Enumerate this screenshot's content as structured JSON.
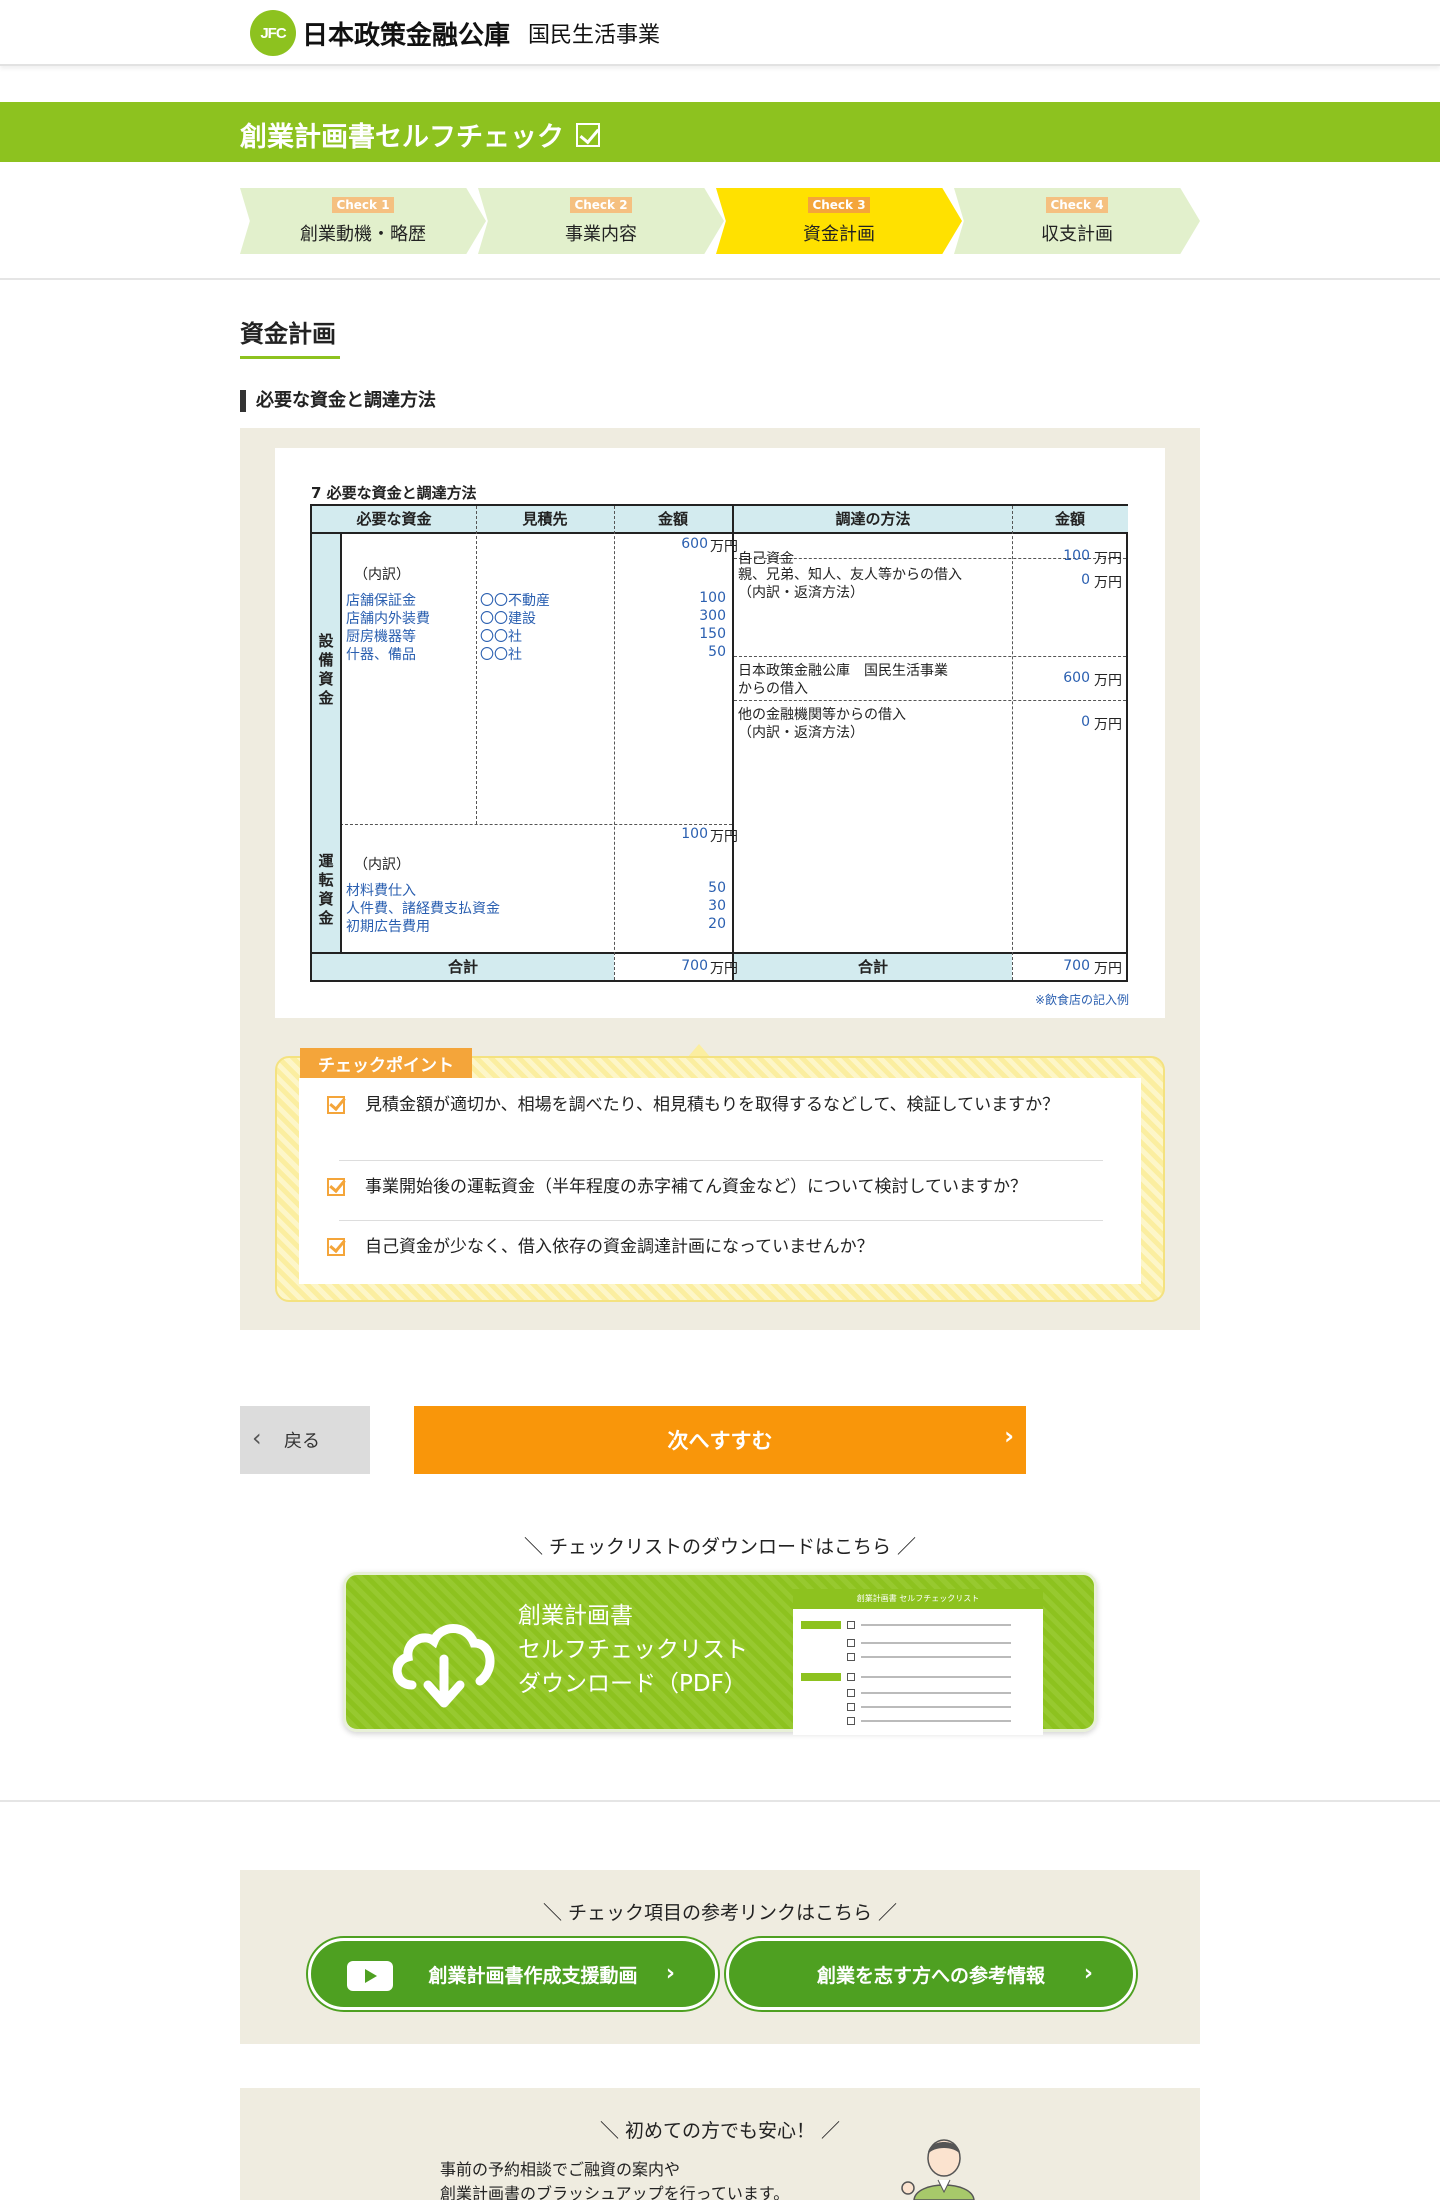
{
  "header": {
    "logo_mark": "JFC",
    "org_name": "日本政策金融公庫",
    "division": "国民生活事業"
  },
  "page_title": "創業計画書セルフチェック",
  "steps": [
    {
      "tag": "Check 1",
      "label": "創業動機・略歴",
      "active": false
    },
    {
      "tag": "Check 2",
      "label": "事業内容",
      "active": false
    },
    {
      "tag": "Check 3",
      "label": "資金計画",
      "active": true
    },
    {
      "tag": "Check 4",
      "label": "収支計画",
      "active": false
    }
  ],
  "section_title": "資金計画",
  "sub_title": "必要な資金と調達方法",
  "funds_table": {
    "caption": "7  必要な資金と調達方法",
    "headers": {
      "need": "必要な資金",
      "vendor": "見積先",
      "amount": "金額",
      "method": "調達の方法",
      "amount2": "金額"
    },
    "equipment": {
      "label": "設備資金",
      "total": "600",
      "breakdown_label": "（内訳）",
      "items": [
        {
          "name": "店舗保証金",
          "vendor": "〇〇不動産",
          "amount": "100"
        },
        {
          "name": "店舗内外装費",
          "vendor": "〇〇建設",
          "amount": "300"
        },
        {
          "name": "厨房機器等",
          "vendor": "〇〇社",
          "amount": "150"
        },
        {
          "name": "什器、備品",
          "vendor": "〇〇社",
          "amount": "50"
        }
      ]
    },
    "operating": {
      "label": "運転資金",
      "total": "100",
      "breakdown_label": "（内訳）",
      "items": [
        {
          "name": "材料費仕入",
          "amount": "50"
        },
        {
          "name": "人件費、諸経費支払資金",
          "amount": "30"
        },
        {
          "name": "初期広告費用",
          "amount": "20"
        }
      ]
    },
    "sources": [
      {
        "line1": "自己資金",
        "line2": "",
        "amount": "100"
      },
      {
        "line1": "親、兄弟、知人、友人等からの借入",
        "line2": "（内訳・返済方法）",
        "amount": "0"
      },
      {
        "line1": "日本政策金融公庫　国民生活事業",
        "line2": "からの借入",
        "amount": "600"
      },
      {
        "line1": "他の金融機関等からの借入",
        "line2": "（内訳・返済方法）",
        "amount": "0"
      }
    ],
    "unit": "万円",
    "total_label": "合計",
    "total_need": "700",
    "total_source": "700",
    "note": "※飲食店の記入例"
  },
  "checkpoint": {
    "tag": "チェックポイント",
    "items": [
      "見積金額が適切か、相場を調べたり、相見積もりを取得するなどして、検証していますか？",
      "事業開始後の運転資金（半年程度の赤字補てん資金など）について検討していますか？",
      "自己資金が少なく、借入依存の資金調達計画になっていませんか？"
    ]
  },
  "nav": {
    "back_label": "戻る",
    "next_label": "次へすすむ"
  },
  "download": {
    "heading": "＼ チェックリストのダウンロードはこちら ／",
    "line1": "創業計画書",
    "line2": "セルフチェックリスト",
    "line3": "ダウンロード（PDF）",
    "thumb_title": "創業計画書 セルフチェックリスト"
  },
  "reference": {
    "heading": "＼ チェック項目の参考リンクはこちら ／",
    "video_label": "創業計画書作成支援動画",
    "info_label": "創業を志す方への参考情報"
  },
  "first_time": {
    "heading": "＼ 初めての方でも安心！ ／",
    "line1": "事前の予約相談でご融資の案内や",
    "line2": "創業計画書のブラッシュアップを行っています。"
  },
  "colors": {
    "brand_green": "#8dc21f",
    "active_step": "#ffe100",
    "accent_orange": "#f9960a",
    "link_green": "#4ea021"
  }
}
